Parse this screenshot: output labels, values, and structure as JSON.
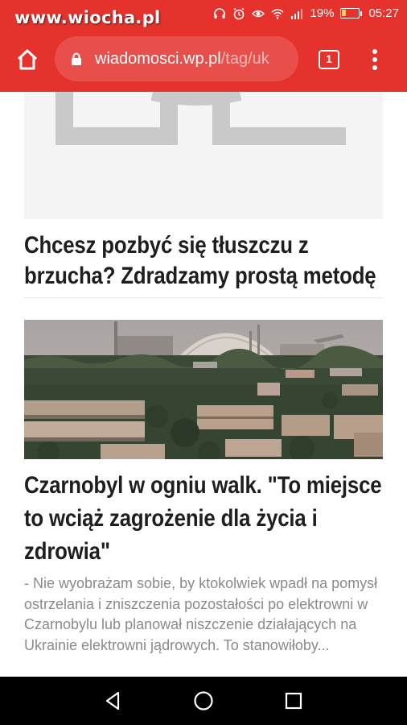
{
  "status_bar": {
    "watermark": "www.wiocha.pl",
    "battery": "19%",
    "time": "05:27",
    "icons": [
      "headphones-icon",
      "alarm-icon",
      "eye-icon",
      "wifi-icon",
      "signal-icon",
      "battery-icon"
    ]
  },
  "browser": {
    "url_domain": "wiadomosci.wp.pl",
    "url_path": "/tag/uk",
    "tab_count": "1",
    "accent": "#e5322d"
  },
  "articles": [
    {
      "title": "Chcesz pozbyć się tłuszczu z brzucha? Zdradzamy prostą metodę"
    },
    {
      "title": "Czarnobyl w ogniu walk. \"To miejsce to wciąż zagrożenie dla życia i zdrowia\"",
      "lead": "- Nie wyobrażam sobie, by ktokolwiek wpadł na pomysł ostrzelania i zniszczenia pozostałości po elektrowni w Czarnobylu lub planował niszczenie działających na Ukrainie elektrowni jądrowych. To stanowiłoby..."
    }
  ],
  "nav": [
    "back-icon",
    "home-icon",
    "recents-icon"
  ]
}
